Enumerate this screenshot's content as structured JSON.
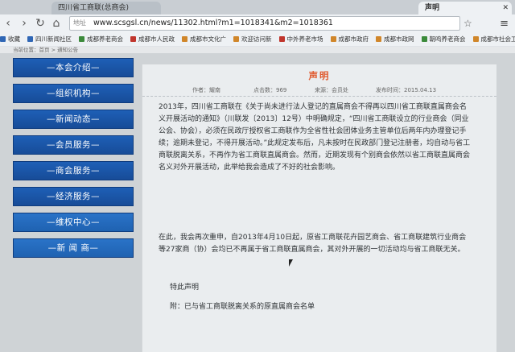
{
  "browser": {
    "tabs": [
      {
        "label": "四川省工商联(总商会)"
      },
      {
        "label": "声明",
        "active": true
      }
    ],
    "url_label": "地址",
    "url": "www.scsgsl.cn/news/11302.html?m1=1018341&m2=1018361",
    "bookmarks": [
      {
        "label": "收藏",
        "icon": "blue"
      },
      {
        "label": "四川新闻社区",
        "icon": "blue"
      },
      {
        "label": "成都养老商会",
        "icon": "green"
      },
      {
        "label": "成都市人民政",
        "icon": "red"
      },
      {
        "label": "成都市文化广",
        "icon": "orange"
      },
      {
        "label": "欢迎访问新",
        "icon": "orange"
      },
      {
        "label": "中外养老市场",
        "icon": "red"
      },
      {
        "label": "成都市政府",
        "icon": "orange"
      },
      {
        "label": "成都市政网",
        "icon": "orange"
      },
      {
        "label": "朝鸣养老商会",
        "icon": "green"
      },
      {
        "label": "成都市社会工",
        "icon": "orange"
      }
    ]
  },
  "breadcrumb": "当前位置：首页 > 通知公告",
  "sidebar": {
    "items": [
      {
        "label": "—本会介绍—"
      },
      {
        "label": "—组织机构—"
      },
      {
        "label": "—新闻动态—"
      },
      {
        "label": "—会员服务—"
      },
      {
        "label": "—商会服务—"
      },
      {
        "label": "—经济服务—"
      },
      {
        "label": "—维权中心—"
      },
      {
        "label": "—新 闻 商—"
      }
    ]
  },
  "article": {
    "title": "声明",
    "author": "作者：耀南",
    "clicks": "点击数：969",
    "source": "来源：会员处",
    "date": "发布时间：2015.04.13",
    "para1": "2013年，四川省工商联在《关于尚未进行法人登记的直属商会不得再以四川省工商联直属商会名义开展活动的通知》（川联发〔2013〕12号）中明确规定，“四川省工商联设立的行业商会（同业公会、协会），必须在民政厅授权省工商联作为全省性社会团体业务主管单位后两年内办理登记手续；逾期未登记，不得开展活动。”此规定发布后，凡未按时在民政部门登记注册者，均自动与省工商联脱离关系，不再作为省工商联直属商会。然而，近期发现有个别商会依然以省工商联直属商会名义对外开展活动，此举给我会造成了不好的社会影响。",
    "para2": "在此，我会再次重申，自2013年4月10日起，原省工商联花卉园艺商会、省工商联建筑行业商会等27家商（协）会均已不再属于省工商联直属商会，其对外开展的一切活动均与省工商联无关。",
    "sign": "特此声明",
    "attachment": "附：已与省工商联脱离关系的原直属商会名单"
  }
}
